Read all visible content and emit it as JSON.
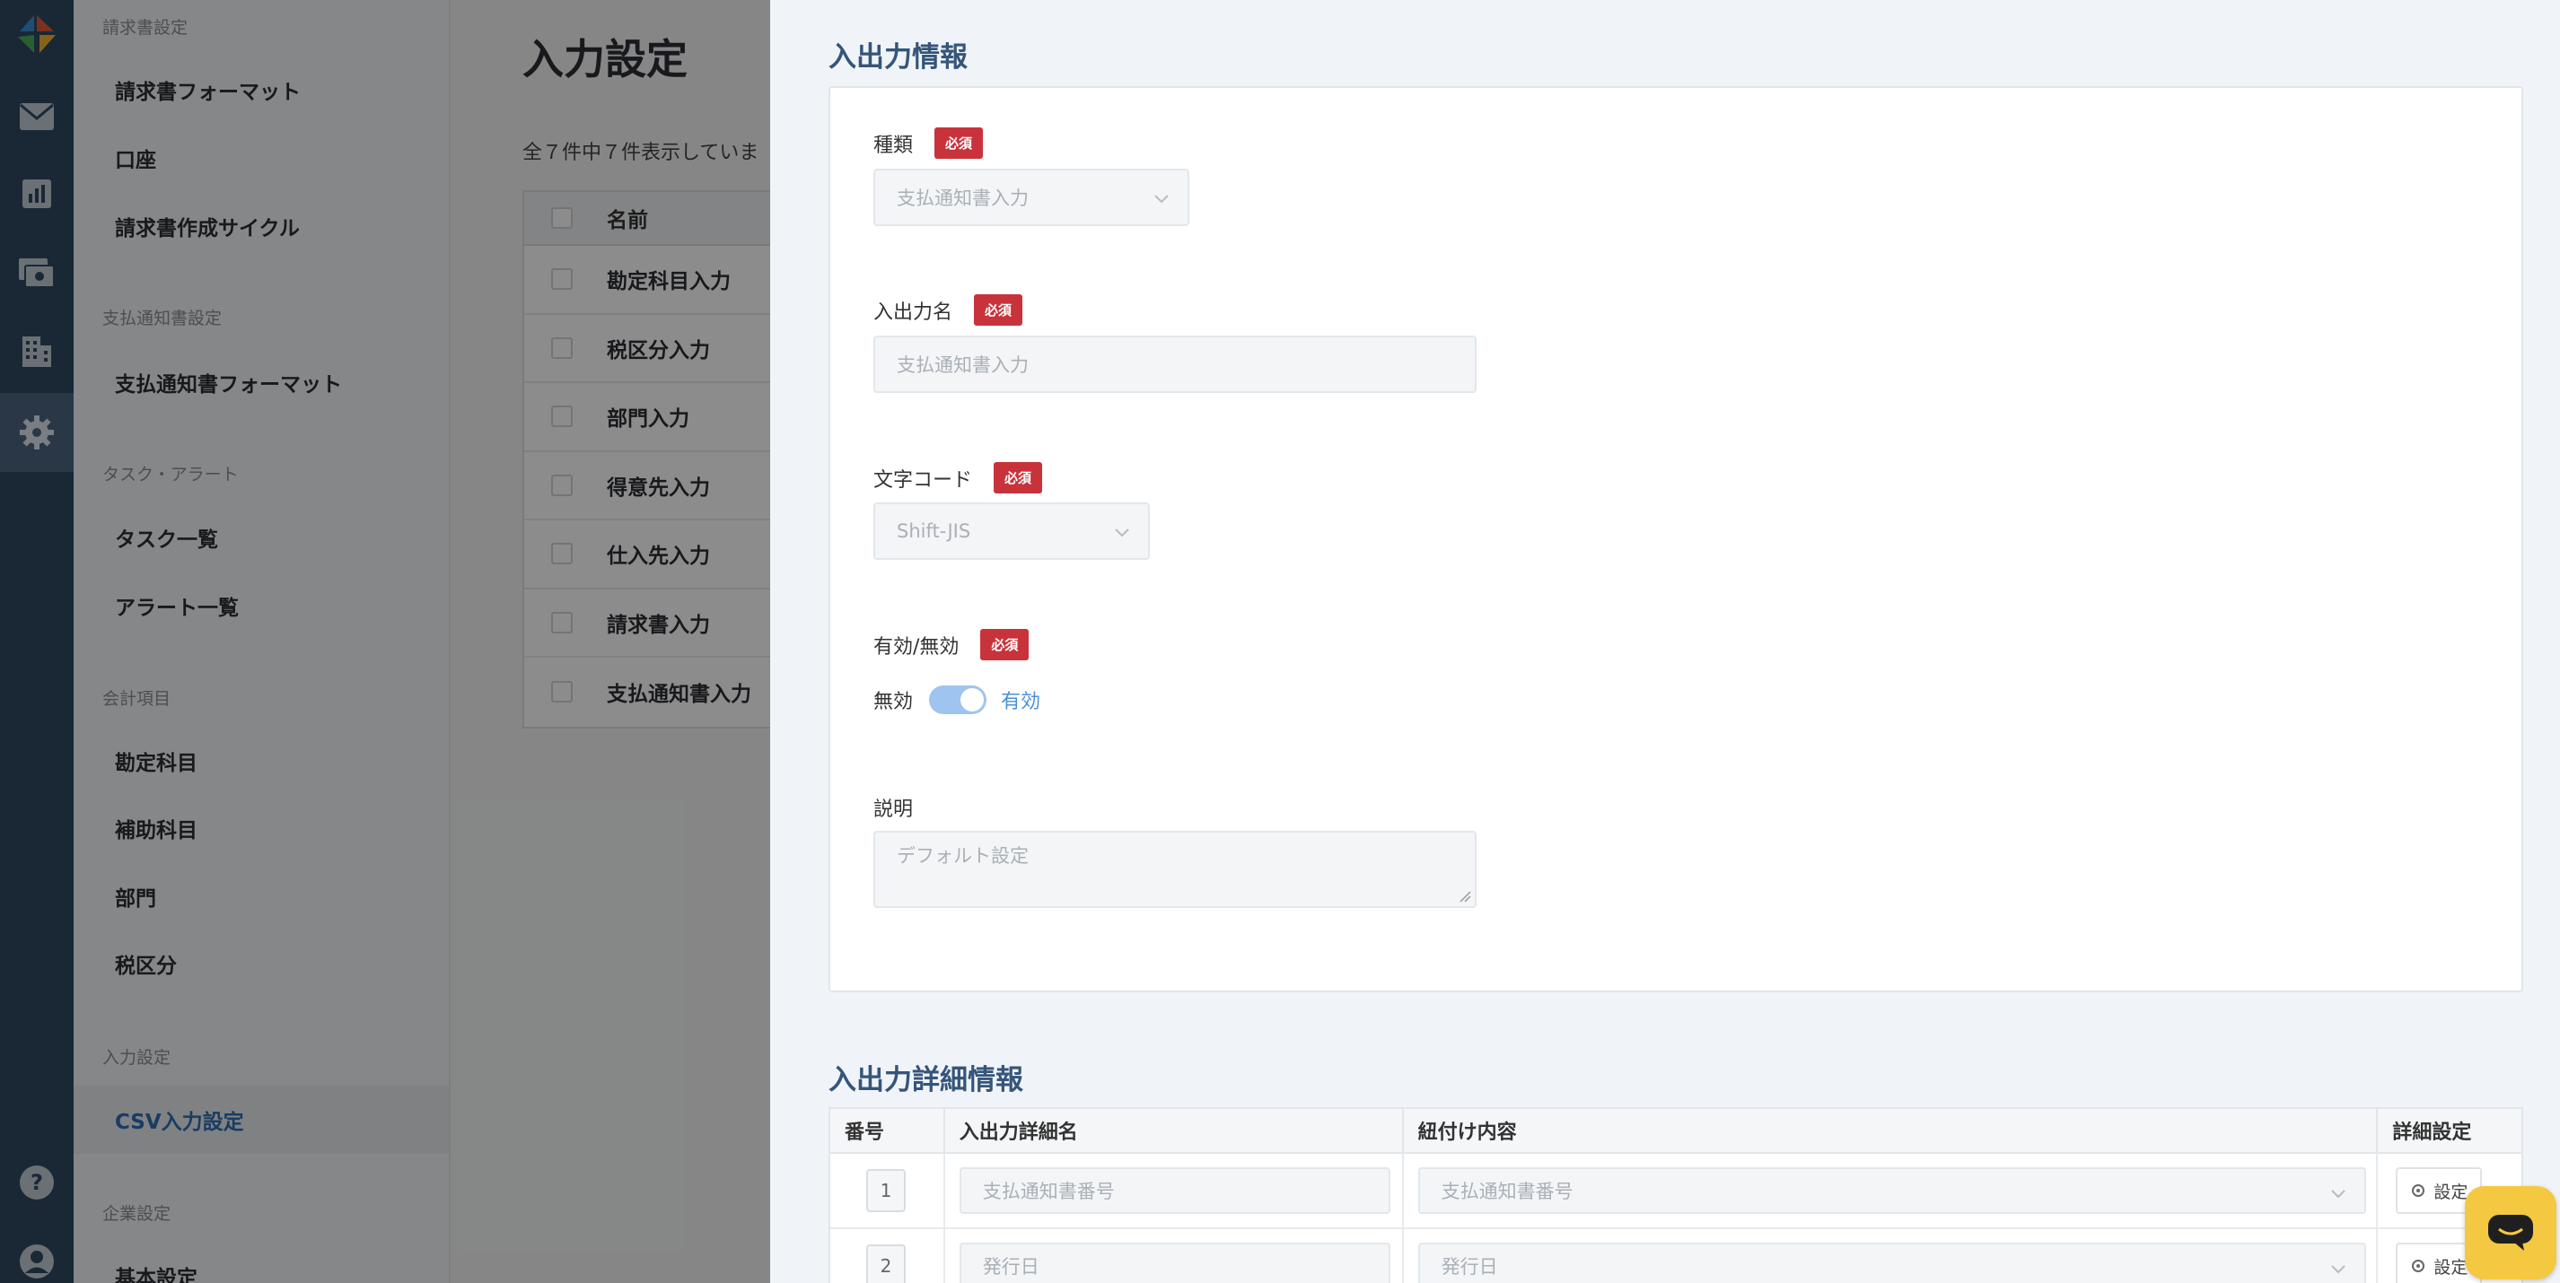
{
  "rail": {
    "icons": [
      "logo-icon",
      "mail-icon",
      "chart-icon",
      "payment-icon",
      "building-icon",
      "gear-icon",
      "help-icon",
      "user-icon"
    ]
  },
  "sidenav": {
    "sections": [
      {
        "title": "請求書設定",
        "items": [
          "請求書フォーマット",
          "口座",
          "請求書作成サイクル"
        ]
      },
      {
        "title": "支払通知書設定",
        "items": [
          "支払通知書フォーマット"
        ]
      },
      {
        "title": "タスク・アラート",
        "items": [
          "タスク一覧",
          "アラート一覧"
        ]
      },
      {
        "title": "会計項目",
        "items": [
          "勘定科目",
          "補助科目",
          "部門",
          "税区分"
        ]
      },
      {
        "title": "入力設定",
        "items": [
          "CSV入力設定"
        ]
      },
      {
        "title": "企業設定",
        "items": [
          "基本設定"
        ]
      }
    ],
    "active_item": "CSV入力設定"
  },
  "main": {
    "title": "入力設定",
    "count_text": "全７件中７件表示していま",
    "table": {
      "header_name": "名前",
      "rows": [
        "勘定科目入力",
        "税区分入力",
        "部門入力",
        "得意先入力",
        "仕入先入力",
        "請求書入力",
        "支払通知書入力"
      ]
    }
  },
  "drawer": {
    "section1_title": "入出力情報",
    "required_badge": "必須",
    "type": {
      "label": "種類",
      "value": "支払通知書入力"
    },
    "io_name": {
      "label": "入出力名",
      "placeholder": "支払通知書入力"
    },
    "charset": {
      "label": "文字コード",
      "value": "Shift-JIS"
    },
    "enabled": {
      "label": "有効/無効",
      "off_label": "無効",
      "on_label": "有効",
      "value": true
    },
    "description": {
      "label": "説明",
      "placeholder": "デフォルト設定"
    },
    "section2_title": "入出力詳細情報",
    "detail_table": {
      "headers": [
        "番号",
        "入出力詳細名",
        "紐付け内容",
        "詳細設定"
      ],
      "rows": [
        {
          "no": "1",
          "name_placeholder": "支払通知書番号",
          "mapping": "支払通知書番号",
          "button": "設定"
        },
        {
          "no": "2",
          "name_placeholder": "発行日",
          "mapping": "発行日",
          "button": "設定"
        }
      ]
    }
  },
  "colors": {
    "rail_bg": "#304a63",
    "accent_blue": "#2f6db5",
    "section_title": "#35557a",
    "required_red": "#c8333b",
    "toggle_on": "#9ec4ef",
    "chat_yellow": "#f4c841"
  }
}
